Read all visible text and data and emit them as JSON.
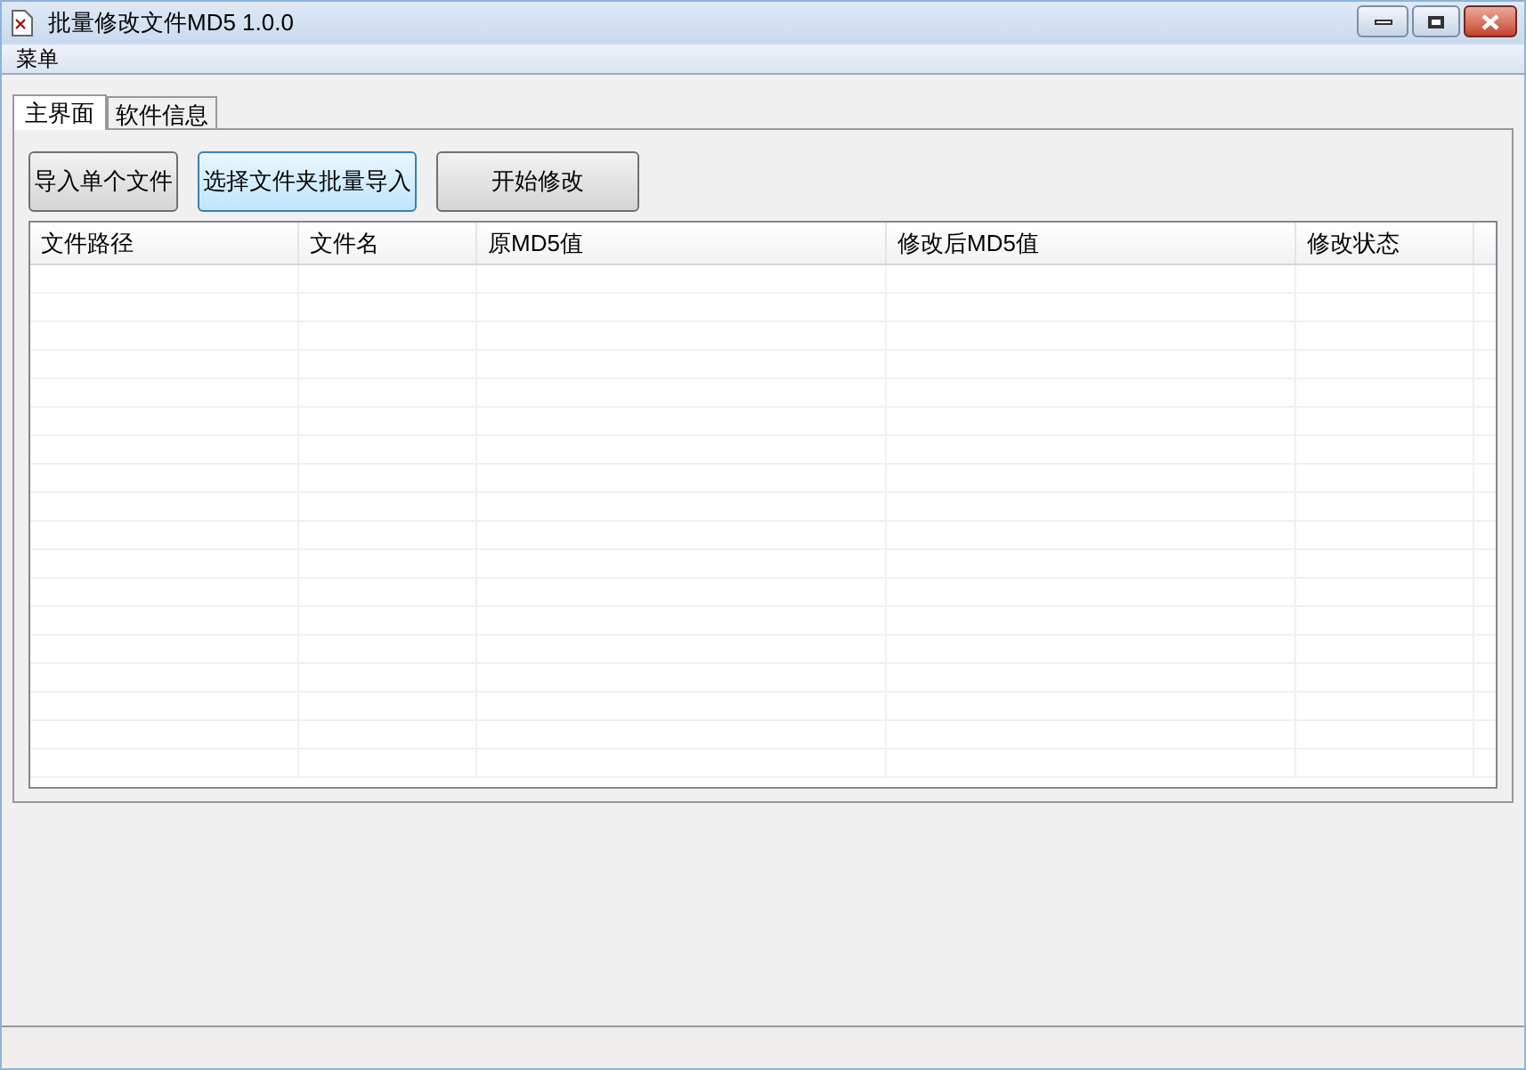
{
  "window": {
    "title": "批量修改文件MD5 1.0.0"
  },
  "menu": [
    "菜单"
  ],
  "tabs": [
    {
      "label": "主界面",
      "selected": true
    },
    {
      "label": "软件信息",
      "selected": false
    }
  ],
  "buttons": [
    {
      "label": "导入单个文件",
      "highlighted": false
    },
    {
      "label": "选择文件夹批量导入",
      "highlighted": true
    },
    {
      "label": "开始修改",
      "highlighted": false
    }
  ],
  "table": {
    "columns": [
      "文件路径",
      "文件名",
      "原MD5值",
      "修改后MD5值",
      "修改状态"
    ]
  }
}
